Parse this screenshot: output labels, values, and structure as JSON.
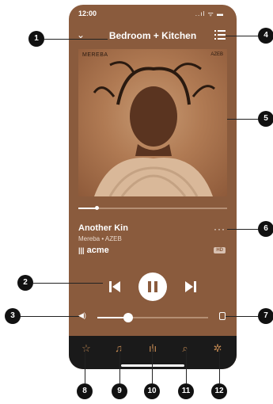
{
  "status": {
    "time": "12:00",
    "signal": "..ıl ᯤ ▬"
  },
  "header": {
    "title": "Bedroom + Kitchen"
  },
  "album": {
    "label_left": "MEREBA",
    "label_right": "AZEB"
  },
  "playback": {
    "progress": 0.12
  },
  "track": {
    "title": "Another Kin",
    "artist": "Mereba • AZEB",
    "source": "acme",
    "quality_badge": "HD",
    "more": "···"
  },
  "volume": {
    "level": 0.28
  },
  "tabs": [
    "favorites-icon",
    "music-icon",
    "rooms-icon",
    "search-icon",
    "settings-icon"
  ],
  "callouts": [
    "1",
    "2",
    "3",
    "4",
    "5",
    "6",
    "7",
    "8",
    "9",
    "10",
    "11",
    "12"
  ],
  "colors": {
    "background": "#8a5b3d",
    "accent": "#c58a52",
    "tabbar": "#1a1a1a"
  }
}
